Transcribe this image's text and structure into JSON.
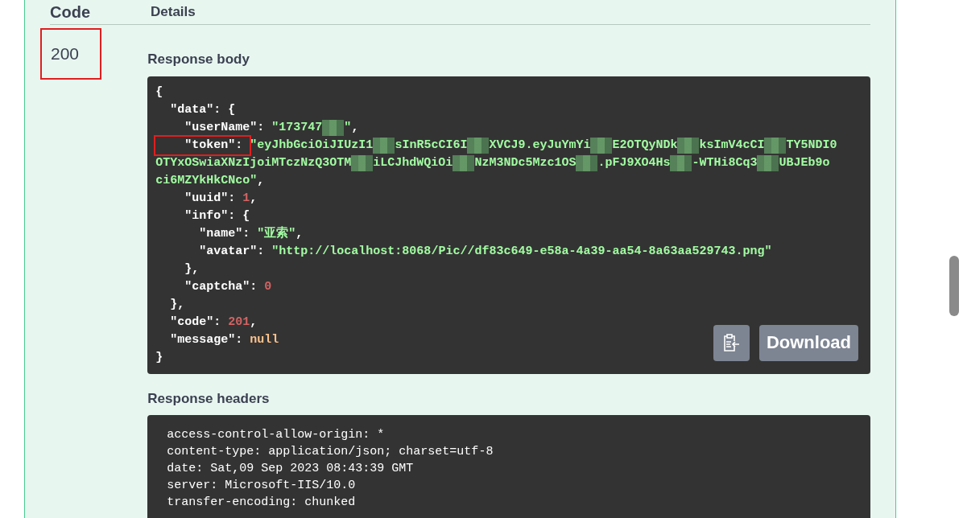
{
  "table": {
    "columns": [
      "Code",
      "Details"
    ],
    "rows": [
      {
        "code": "200",
        "code_highlighted": true,
        "response_body": {
          "title": "Response body",
          "lines": [
            [
              {
                "kind": "punct",
                "text": "{"
              }
            ],
            [
              {
                "kind": "punct",
                "text": "  \"data\": {"
              }
            ],
            [
              {
                "kind": "key",
                "text": "    \"userName\": "
              },
              {
                "kind": "string",
                "text": "\"173747"
              },
              {
                "kind": "masked"
              },
              {
                "kind": "string",
                "text": "\""
              },
              {
                "kind": "punct",
                "text": ","
              }
            ],
            [
              {
                "kind": "key",
                "text": "    \"token\": ",
                "highlighted": true
              },
              {
                "kind": "string",
                "text": "\"eyJhbGciOiJIUzI1"
              },
              {
                "kind": "masked"
              },
              {
                "kind": "string",
                "text": "sInR5cCI6I"
              },
              {
                "kind": "masked"
              },
              {
                "kind": "string",
                "text": "XVCJ9.eyJuYmYi"
              },
              {
                "kind": "masked"
              },
              {
                "kind": "string",
                "text": "E2OTQyNDk"
              },
              {
                "kind": "masked"
              },
              {
                "kind": "string",
                "text": "ksImV4cCI"
              },
              {
                "kind": "masked"
              },
              {
                "kind": "string",
                "text": "TY5NDI0"
              }
            ],
            [
              {
                "kind": "string",
                "text": "OTYxOSwiaXNzIjoiMTczNzQ3OTM"
              },
              {
                "kind": "masked"
              },
              {
                "kind": "string",
                "text": "iLCJhdWQiOi"
              },
              {
                "kind": "masked"
              },
              {
                "kind": "string",
                "text": "NzM3NDc5Mzc1OS"
              },
              {
                "kind": "masked"
              },
              {
                "kind": "string",
                "text": ".pFJ9XO4Hs"
              },
              {
                "kind": "masked"
              },
              {
                "kind": "string",
                "text": "-WTHi8Cq3"
              },
              {
                "kind": "masked"
              },
              {
                "kind": "string",
                "text": "UBJEb9o"
              }
            ],
            [
              {
                "kind": "string",
                "text": "ci6MZYkHkCNco\""
              },
              {
                "kind": "punct",
                "text": ","
              }
            ],
            [
              {
                "kind": "key",
                "text": "    \"uuid\": "
              },
              {
                "kind": "number",
                "text": "1"
              },
              {
                "kind": "punct",
                "text": ","
              }
            ],
            [
              {
                "kind": "key",
                "text": "    \"info\": "
              },
              {
                "kind": "punct",
                "text": "{"
              }
            ],
            [
              {
                "kind": "key",
                "text": "      \"name\": "
              },
              {
                "kind": "string",
                "text": "\"亚索\""
              },
              {
                "kind": "punct",
                "text": ","
              }
            ],
            [
              {
                "kind": "key",
                "text": "      \"avatar\": "
              },
              {
                "kind": "string",
                "text": "\"http://localhost:8068/Pic//df83c649-e58a-4a39-aa54-8a63aa529743.png\""
              }
            ],
            [
              {
                "kind": "punct",
                "text": "    },"
              }
            ],
            [
              {
                "kind": "key",
                "text": "    \"captcha\": "
              },
              {
                "kind": "number",
                "text": "0"
              }
            ],
            [
              {
                "kind": "punct",
                "text": "  },"
              }
            ],
            [
              {
                "kind": "key",
                "text": "  \"code\": "
              },
              {
                "kind": "number",
                "text": "201"
              },
              {
                "kind": "punct",
                "text": ","
              }
            ],
            [
              {
                "kind": "key",
                "text": "  \"message\": "
              },
              {
                "kind": "null",
                "text": "null"
              }
            ],
            [
              {
                "kind": "punct",
                "text": "}"
              }
            ]
          ],
          "download_button": "Download"
        },
        "response_headers": {
          "title": "Response headers",
          "lines": [
            "access-control-allow-origin: *",
            "content-type: application/json; charset=utf-8",
            "date: Sat,09 Sep 2023 08:43:39 GMT",
            "server: Microsoft-IIS/10.0",
            "transfer-encoding: chunked"
          ]
        }
      }
    ]
  }
}
